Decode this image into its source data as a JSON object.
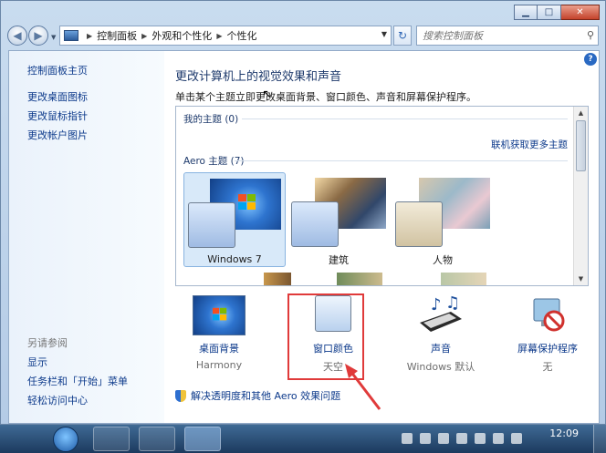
{
  "window": {
    "caption": {
      "minimize": "▁",
      "maximize": "□",
      "close": "✕"
    }
  },
  "nav": {
    "back": "◀",
    "forward": "▶",
    "breadcrumb": [
      "控制面板",
      "外观和个性化",
      "个性化"
    ],
    "search_placeholder": "搜索控制面板"
  },
  "sidebar": {
    "links": [
      "控制面板主页",
      "更改桌面图标",
      "更改鼠标指针",
      "更改帐户图片"
    ],
    "see_also_heading": "另请参阅",
    "see_also": [
      "显示",
      "任务栏和「开始」菜单",
      "轻松访问中心"
    ]
  },
  "main": {
    "title": "更改计算机上的视觉效果和声音",
    "description": "单击某个主题立即更改桌面背景、窗口颜色、声音和屏幕保护程序。",
    "my_themes": "我的主题 (0)",
    "get_more": "联机获取更多主题",
    "aero_themes": "Aero 主题 (7)",
    "themes": [
      {
        "label": "Windows 7"
      },
      {
        "label": "建筑"
      },
      {
        "label": "人物"
      }
    ]
  },
  "settings": [
    {
      "label": "桌面背景",
      "value": "Harmony"
    },
    {
      "label": "窗口颜色",
      "value": "天空"
    },
    {
      "label": "声音",
      "value": "Windows 默认"
    },
    {
      "label": "屏幕保护程序",
      "value": "无"
    }
  ],
  "fix_link": "解决透明度和其他 Aero 效果问题",
  "taskbar": {
    "clock": "12:09"
  },
  "colors": {
    "link": "#0d3a8b",
    "title": "#1e3a6c",
    "highlight": "#e03a3a",
    "selected_theme": "#d8e9f9"
  }
}
